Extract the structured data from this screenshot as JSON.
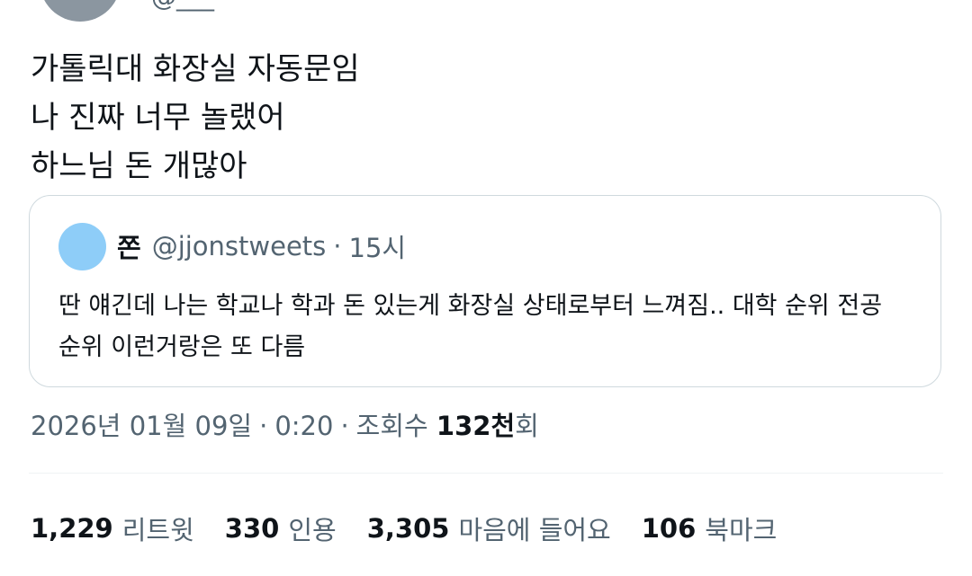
{
  "author": {
    "handle_partial": "@___"
  },
  "tweet": {
    "lines": [
      "가톨릭대 화장실 자동문임",
      "나 진짜 너무 놀랬어",
      "하느님 돈 개많아"
    ]
  },
  "quoted_tweet": {
    "name": "쫀",
    "handle": "@jjonstweets",
    "separator": "·",
    "time": "15시",
    "text_line1": "딴 얘긴데 나는 학교나 학과 돈 있는게 화장실 상태로부터 느껴짐.. 대학 순위 전공",
    "text_line2": "순위 이런거랑은 또 다름"
  },
  "meta": {
    "date": "2026년 01월 09일",
    "separator": "·",
    "time": "0:20",
    "views_label": "조회수",
    "views_number": "132천",
    "views_suffix": "회"
  },
  "stats": {
    "retweets": {
      "count": "1,229",
      "label": "리트윗"
    },
    "quotes": {
      "count": "330",
      "label": "인용"
    },
    "likes": {
      "count": "3,305",
      "label": "마음에 들어요"
    },
    "bookmarks": {
      "count": "106",
      "label": "북마크"
    }
  }
}
